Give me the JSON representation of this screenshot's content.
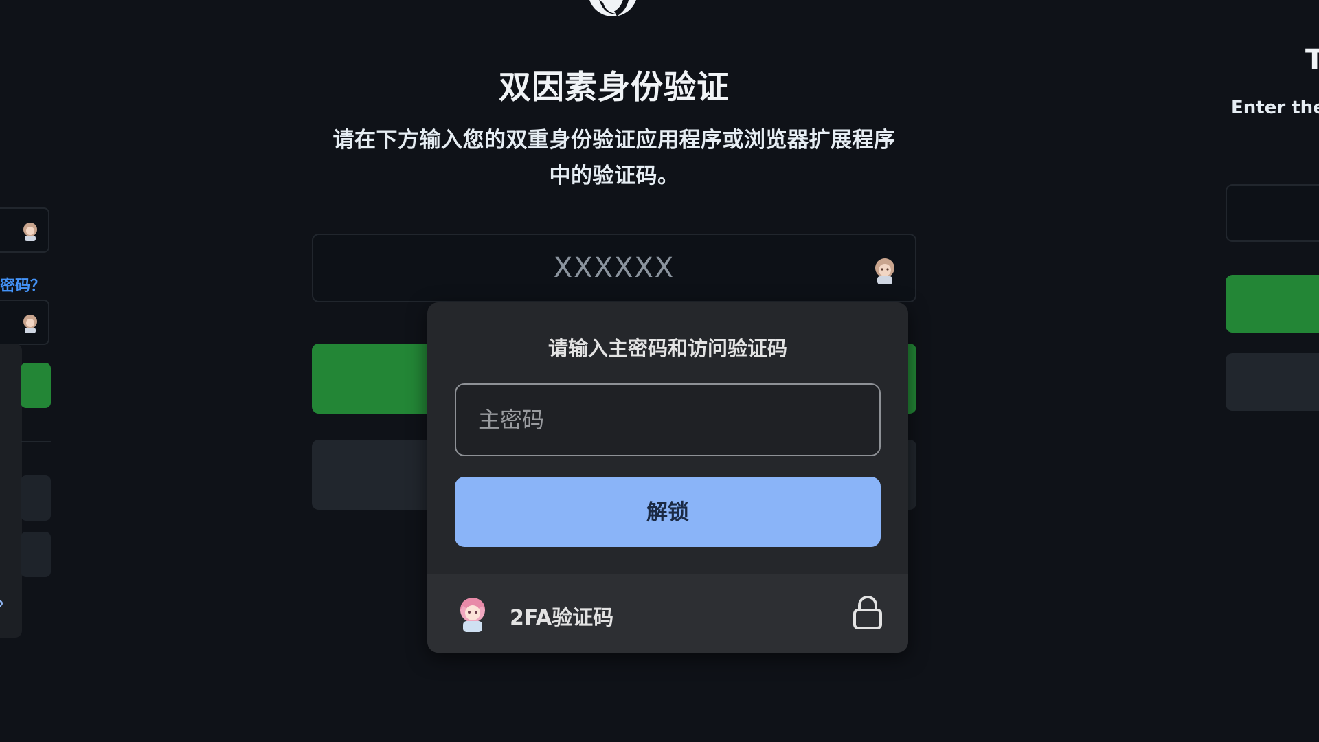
{
  "main": {
    "title": "双因素身份验证",
    "subtitle": "请在下方输入您的双重身份验证应用程序或浏览器扩展程序中的验证码。",
    "code_field": {
      "placeholder": "XXXXXX",
      "value": ""
    },
    "primary_button_color": "#238636",
    "secondary_button_color": "#21262d"
  },
  "left_panel": {
    "link_text": "密码？",
    "link_color": "#4493f8"
  },
  "right_panel": {
    "title": "T",
    "subtitle": "Enter the c"
  },
  "autofill_popup": {
    "title": "请输入主密码和访问验证码",
    "password_field": {
      "placeholder": "主密码",
      "value": ""
    },
    "unlock_label": "解锁",
    "unlock_color": "#8ab4f8",
    "footer_item": {
      "label": "2FA验证码",
      "icon": "lock-icon",
      "avatar": "anime-avatar"
    }
  },
  "icons": {
    "logo": "github-logo",
    "field_avatar": "anime-avatar",
    "lock": "lock-icon"
  },
  "colors": {
    "background": "#0f1218",
    "accent_green": "#238636",
    "popup_bg": "#25272b"
  }
}
